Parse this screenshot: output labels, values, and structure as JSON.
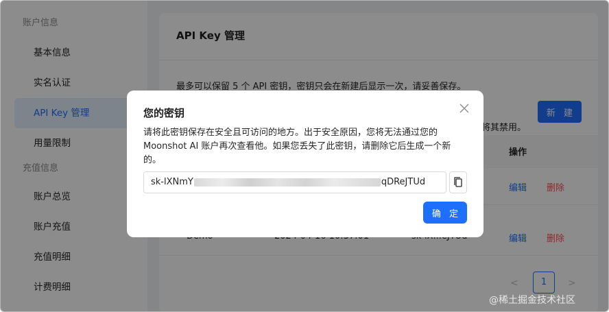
{
  "sidebar": {
    "groups": [
      {
        "label": "账户信息",
        "items": [
          "基本信息",
          "实名认证",
          "API Key 管理",
          "用量限制"
        ]
      },
      {
        "label": "充值信息",
        "items": [
          "账户总览",
          "账户充值",
          "充值明细",
          "计费明细"
        ]
      }
    ],
    "active": "API Key 管理"
  },
  "main": {
    "title": "API Key 管理",
    "description": "最多可以保留 5 个 API 密钥，密钥只会在新建后显示一次，请妥善保存。",
    "description_tail": "将其禁用。",
    "new_button": "新 建",
    "table": {
      "ops_header": "操作",
      "rows": [
        {
          "name": "",
          "date": "",
          "key": "",
          "edit": "编辑",
          "delete": "删除"
        },
        {
          "name": "Demo",
          "date": "2024-04-16 10:37:01",
          "key": "sk-lX...eJTUd",
          "edit": "编辑",
          "delete": "删除"
        }
      ]
    },
    "pagination": {
      "prev": "<",
      "current": "1",
      "next": ">"
    }
  },
  "modal": {
    "title": "您的密钥",
    "body": "请将此密钥保存在安全且可访问的地方。出于安全原因，您将无法通过您的 Moonshot AI 账户再次查看他。如果您丢失了此密钥，请删除它后生成一个新的。",
    "key_prefix": "sk-lXNmY",
    "key_suffix": "qDReJTUd",
    "confirm": "确 定"
  },
  "watermark": "@稀土掘金技术社区",
  "colors": {
    "accent": "#1f6fff",
    "danger": "#ff4d4f",
    "active_bg": "#e6f0ff"
  }
}
